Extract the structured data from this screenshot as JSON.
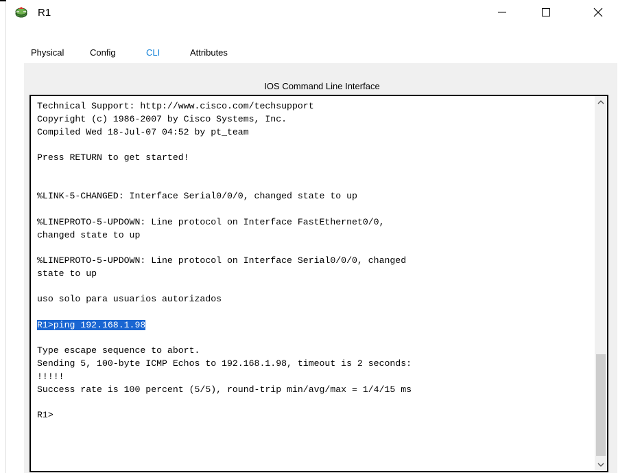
{
  "window": {
    "title": "R1"
  },
  "tabs": [
    {
      "label": "Physical"
    },
    {
      "label": "Config"
    },
    {
      "label": "CLI",
      "active": true
    },
    {
      "label": "Attributes"
    }
  ],
  "panel": {
    "title": "IOS Command Line Interface"
  },
  "terminal": {
    "lines": [
      "Technical Support: http://www.cisco.com/techsupport",
      "Copyright (c) 1986-2007 by Cisco Systems, Inc.",
      "Compiled Wed 18-Jul-07 04:52 by pt_team",
      "",
      "Press RETURN to get started!",
      "",
      "",
      "%LINK-5-CHANGED: Interface Serial0/0/0, changed state to up",
      "",
      "%LINEPROTO-5-UPDOWN: Line protocol on Interface FastEthernet0/0,",
      "changed state to up",
      "",
      "%LINEPROTO-5-UPDOWN: Line protocol on Interface Serial0/0/0, changed",
      "state to up",
      "",
      "uso solo para usuarios autorizados",
      "",
      "R1>ping 192.168.1.98",
      "",
      "Type escape sequence to abort.",
      "Sending 5, 100-byte ICMP Echos to 192.168.1.98, timeout is 2 seconds:",
      "!!!!!",
      "Success rate is 100 percent (5/5), round-trip min/avg/max = 1/4/15 ms",
      "",
      "R1>"
    ],
    "highlighted_line": 17
  },
  "colors": {
    "accent": "#0a7dd6",
    "selection": "#1a66d2",
    "panel_bg": "#f0f0f0"
  },
  "icons": {
    "app": "router-icon",
    "minimize": "minimize-icon",
    "maximize": "maximize-icon",
    "close": "close-icon",
    "scroll_up": "chevron-up-icon",
    "scroll_down": "chevron-down-icon"
  }
}
